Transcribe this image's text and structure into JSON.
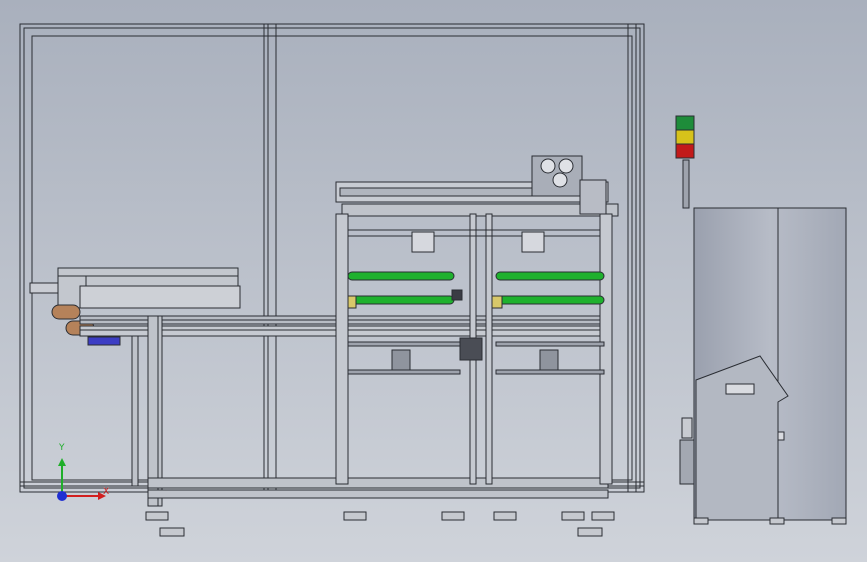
{
  "viewport": {
    "background_top": "#a9b0bd",
    "background_bottom": "#cfd3da"
  },
  "triad": {
    "x_label": "X",
    "y_label": "Y",
    "x_color": "#d21f1f",
    "y_color": "#1fae2a",
    "z_color": "#1f2fd2"
  },
  "stack_light": {
    "top_color": "#1e8c3a",
    "middle_color": "#d7c21a",
    "bottom_color": "#c21a1a"
  },
  "rollers": {
    "color": "#1fb12e"
  },
  "icons": [
    "coordinate-triad-icon"
  ]
}
